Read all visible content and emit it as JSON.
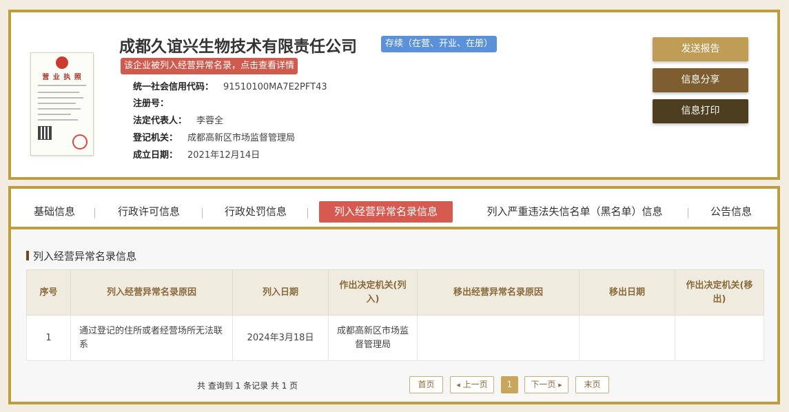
{
  "company": {
    "name": "成都久谊兴生物技术有限责任公司",
    "status": "存续（在营、开业、在册）",
    "abnormal_notice": "该企业被列入经营异常名录，点击查看详情",
    "license_title": "营 业 执 照",
    "fields": [
      {
        "label": "统一社会信用代码：",
        "value": "91510100MA7E2PFT43"
      },
      {
        "label": "注册号：",
        "value": ""
      },
      {
        "label": "法定代表人：",
        "value": "李蓉全"
      },
      {
        "label": "登记机关：",
        "value": "成都高新区市场监督管理局"
      },
      {
        "label": "成立日期：",
        "value": "2021年12月14日"
      }
    ]
  },
  "actions": {
    "report": "发送报告",
    "share": "信息分享",
    "print": "信息打印"
  },
  "tabs": [
    {
      "label": "基础信息"
    },
    {
      "label": "行政许可信息"
    },
    {
      "label": "行政处罚信息"
    },
    {
      "label": "列入经营异常名录信息",
      "active": true
    },
    {
      "label": "列入严重违法失信名单（黑名单）信息"
    },
    {
      "label": "公告信息"
    }
  ],
  "section": {
    "title": "列入经营异常名录信息",
    "columns": [
      "序号",
      "列入经营异常名录原因",
      "列入日期",
      "作出决定机关(列入)",
      "移出经营异常名录原因",
      "移出日期",
      "作出决定机关(移出)"
    ],
    "rows": [
      [
        "1",
        "通过登记的住所或者经营场所无法联系",
        "2024年3月18日",
        "成都高新区市场监督管理局",
        "",
        "",
        ""
      ]
    ]
  },
  "pagination": {
    "summary": "共 查询到 1 条记录 共 1 页",
    "first": "首页",
    "prev": "上一页",
    "current": "1",
    "next": "下一页",
    "last": "末页"
  },
  "colors": {
    "frame": "#bf9d3f",
    "status_blue": "#5a91d8",
    "alert_red": "#cf5b4e",
    "active_tab": "#d65a50"
  },
  "icons": {
    "prev": "triangle-left-icon",
    "next": "triangle-right-icon"
  }
}
